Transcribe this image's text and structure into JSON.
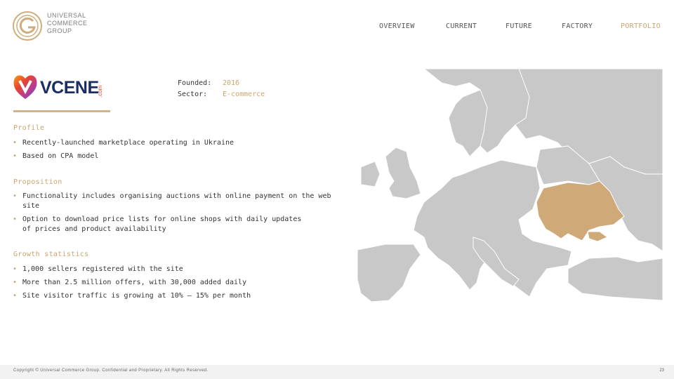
{
  "header": {
    "logo_lines": [
      "UNIVERSAL",
      "COMMERCE",
      "GROUP"
    ],
    "nav": [
      {
        "label": "OVERVIEW",
        "active": false
      },
      {
        "label": "CURRENT",
        "active": false
      },
      {
        "label": "FUTURE",
        "active": false
      },
      {
        "label": "FACTORY",
        "active": false
      },
      {
        "label": "PORTFOLIO",
        "active": true
      }
    ]
  },
  "company": {
    "brand_name": "VCENE",
    "brand_suffix": ".com",
    "founded_label": "Founded:",
    "founded_value": "2016",
    "sector_label": "Sector:",
    "sector_value": "E-commerce"
  },
  "sections": [
    {
      "title": "Profile",
      "bullets": [
        "Recently-launched marketplace operating in Ukraine",
        "Based on CPA model"
      ]
    },
    {
      "title": "Proposition",
      "bullets": [
        "Functionality includes organising auctions with online payment on the web site",
        "Option to download price lists for online shops with daily updates of prices and product availability"
      ]
    },
    {
      "title": "Growth statistics",
      "bullets": [
        "1,000 sellers registered with the site",
        "More than 2.5 million offers, with 30,000 added daily",
        "Site visitor traffic is growing at 10% — 15% per month"
      ]
    }
  ],
  "map": {
    "highlighted_country": "Ukraine",
    "highlight_color": "#cfa977",
    "land_color": "#c8c8c8",
    "sea_color": "#ffffff"
  },
  "footer": {
    "copyright": "Copyright © Universal Commerce Group. Confidential and Proprietary. All Rights Reserved.",
    "page_number": "23"
  },
  "colors": {
    "accent": "#c9a56e",
    "brand_navy": "#1b2e63"
  }
}
